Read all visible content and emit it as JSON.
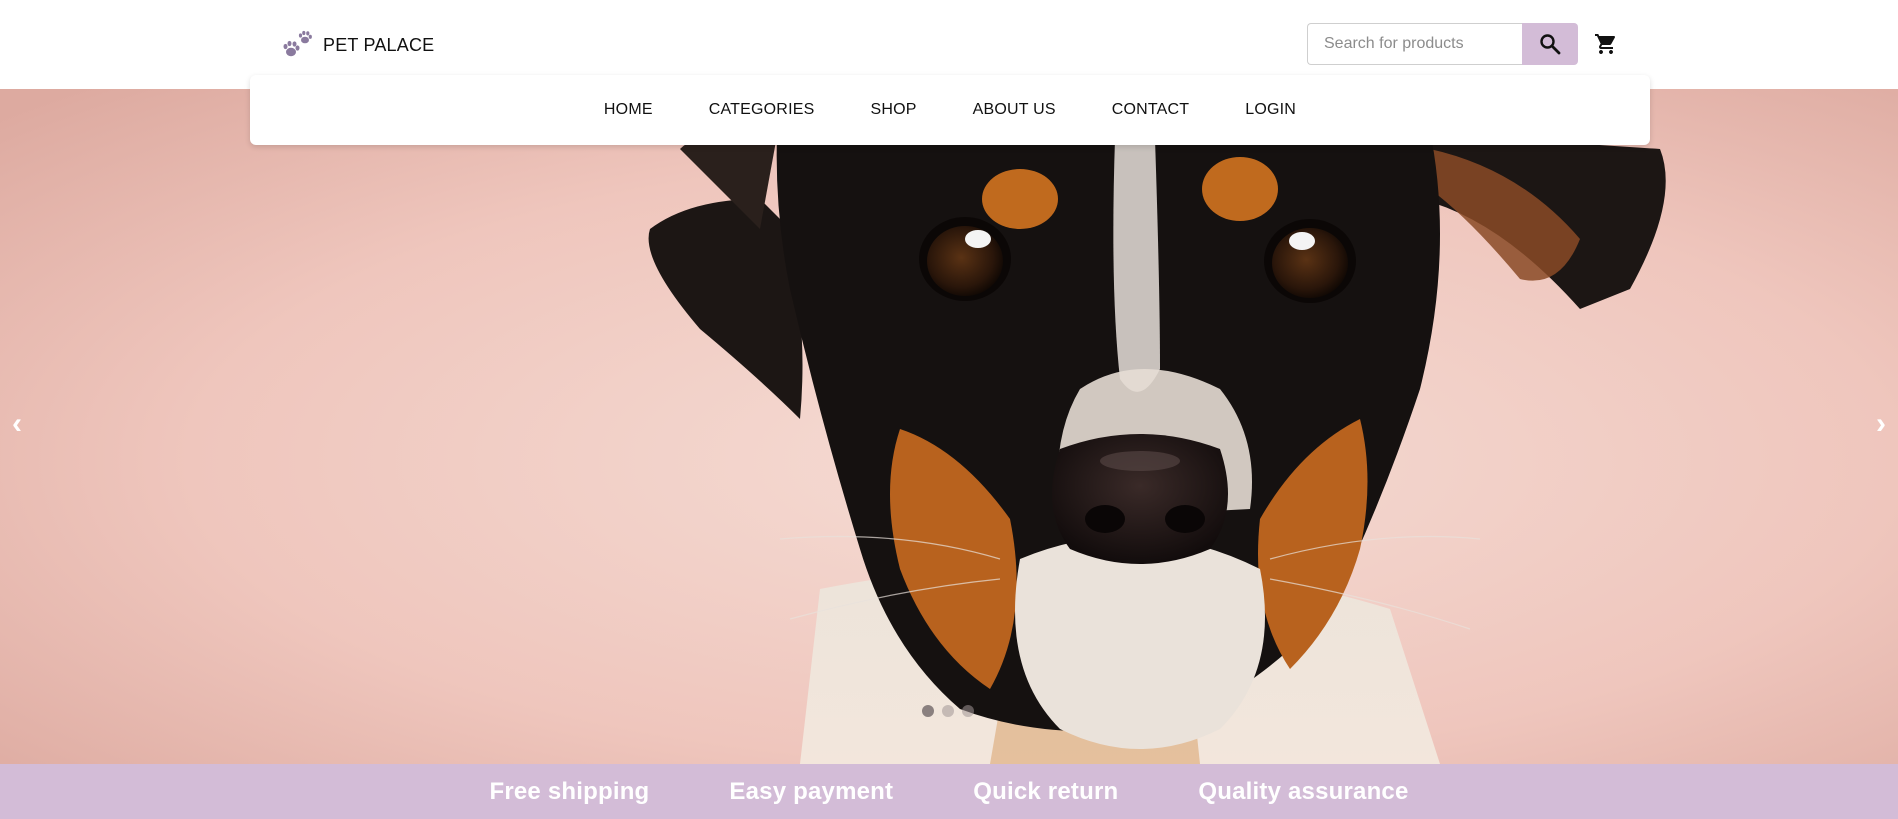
{
  "header": {
    "brand": "PET PALACE",
    "logo_icon": "paw-prints-icon",
    "search": {
      "placeholder": "Search for products",
      "value": "",
      "icon": "search-icon"
    },
    "cart_icon": "shopping-cart-icon"
  },
  "nav": {
    "items": [
      {
        "label": "HOME"
      },
      {
        "label": "CATEGORIES"
      },
      {
        "label": "SHOP"
      },
      {
        "label": "ABOUT US"
      },
      {
        "label": "CONTACT"
      },
      {
        "label": "LOGIN"
      }
    ]
  },
  "hero": {
    "image": "dog-portrait",
    "prev_arrow": "‹",
    "next_arrow": "›",
    "slide_count": 3,
    "active_slide": 1
  },
  "features": [
    {
      "label": "Free shipping"
    },
    {
      "label": "Easy payment"
    },
    {
      "label": "Quick return"
    },
    {
      "label": "Quality assurance"
    }
  ],
  "colors": {
    "accent": "#d3bcd7",
    "logo_paw": "#8a7a9e",
    "hero_background": "#efc4bb"
  }
}
